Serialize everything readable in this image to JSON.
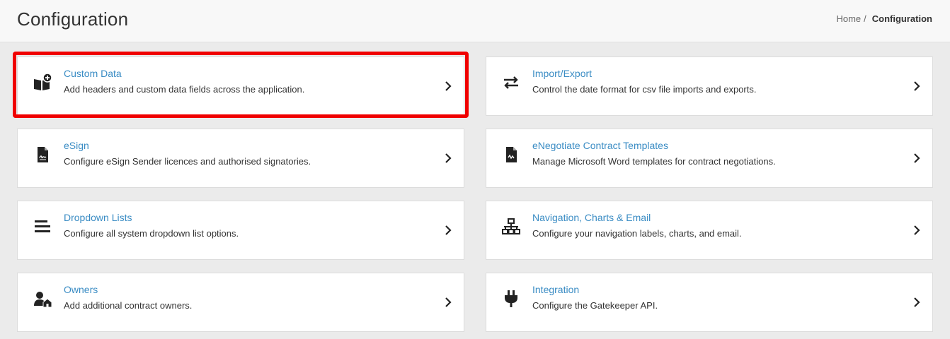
{
  "header": {
    "title": "Configuration",
    "breadcrumb": {
      "home": "Home",
      "separator": "/",
      "current": "Configuration"
    }
  },
  "cards": [
    {
      "title": "Custom Data",
      "description": "Add headers and custom data fields across the application.",
      "icon": "book-plus-icon"
    },
    {
      "title": "Import/Export",
      "description": "Control the date format for csv file imports and exports.",
      "icon": "exchange-icon"
    },
    {
      "title": "eSign",
      "description": "Configure eSign Sender licences and authorised signatories.",
      "icon": "signature-doc-icon"
    },
    {
      "title": "eNegotiate Contract Templates",
      "description": "Manage Microsoft Word templates for contract negotiations.",
      "icon": "doc-signature-icon"
    },
    {
      "title": "Dropdown Lists",
      "description": "Configure all system dropdown list options.",
      "icon": "list-icon"
    },
    {
      "title": "Navigation, Charts & Email",
      "description": "Configure your navigation labels, charts, and email.",
      "icon": "network-icon"
    },
    {
      "title": "Owners",
      "description": "Add additional contract owners.",
      "icon": "user-house-icon"
    },
    {
      "title": "Integration",
      "description": "Configure the Gatekeeper API.",
      "icon": "plug-icon"
    }
  ],
  "colors": {
    "link": "#3a8cc4",
    "highlight": "#f00000"
  }
}
